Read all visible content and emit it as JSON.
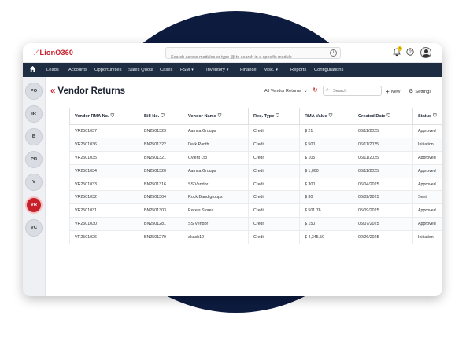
{
  "header": {
    "logo_mark": "⟋",
    "logo_text": "LionO",
    "logo_num": "360",
    "search_placeholder": "Search across modules or type @ to search in a specific module",
    "notif_count": "1",
    "icons": [
      "bell-icon",
      "help-icon",
      "user-avatar"
    ]
  },
  "nav": {
    "items": [
      {
        "label": "Leads",
        "dropdown": false
      },
      {
        "label": "Accounts",
        "dropdown": false
      },
      {
        "label": "Opportunities",
        "dropdown": false
      },
      {
        "label": "Sales Quota",
        "dropdown": false
      },
      {
        "label": "Cases",
        "dropdown": false
      },
      {
        "label": "FSM",
        "dropdown": true
      },
      {
        "label": "Inventory",
        "dropdown": true
      },
      {
        "label": "Finance",
        "dropdown": false
      },
      {
        "label": "Misc.",
        "dropdown": true
      },
      {
        "label": "Reports",
        "dropdown": false
      },
      {
        "label": "Configurations",
        "dropdown": false
      }
    ]
  },
  "sidebar": {
    "items": [
      {
        "label": "PO",
        "active": false
      },
      {
        "label": "IR",
        "active": false
      },
      {
        "label": "B",
        "active": false
      },
      {
        "label": "PR",
        "active": false
      },
      {
        "label": "V",
        "active": false
      },
      {
        "label": "VR",
        "active": true
      },
      {
        "label": "VC",
        "active": false
      }
    ]
  },
  "page": {
    "back_glyph": "«",
    "title": "Vendor Returns",
    "view_selector": "All Vendor Returns",
    "search_placeholder": "Search",
    "new_label": "New",
    "settings_label": "Settings"
  },
  "table": {
    "columns": [
      "Vendor RMA No.",
      "Bill No.",
      "Vendor Name",
      "Req. Type",
      "RMA Value",
      "Created Date",
      "Status"
    ],
    "rows": [
      [
        "VR2501037",
        "BN2501323",
        "Aamca Groups",
        "Credit",
        "$ 21",
        "06/11/2025",
        "Approved"
      ],
      [
        "VR2501036",
        "BN2501322",
        "Dark Panth",
        "Credit",
        "$ 500",
        "06/11/2025",
        "Initiation"
      ],
      [
        "VR2501035",
        "BN2501321",
        "Cylent Ltd",
        "Credit",
        "$ 105",
        "06/11/2025",
        "Approved"
      ],
      [
        "VR2501034",
        "BN2501320",
        "Aamca Groups",
        "Credit",
        "$ 1,000",
        "06/11/2025",
        "Approved"
      ],
      [
        "VR2501033",
        "BN2501316",
        "SS Vendor",
        "Credit",
        "$ 300",
        "06/04/2025",
        "Approved"
      ],
      [
        "VR2501032",
        "BN2501304",
        "Rock Band groups",
        "Credit",
        "$ 30",
        "06/02/2025",
        "Sent"
      ],
      [
        "VR2501031",
        "BN2501303",
        "Excels Stores",
        "Credit",
        "$ 501.76",
        "05/09/2025",
        "Approved"
      ],
      [
        "VR2501030",
        "BN2501281",
        "SS Vendor",
        "Credit",
        "$ 150",
        "05/07/2025",
        "Approved"
      ],
      [
        "VR2501026",
        "BN2501279",
        "akash12",
        "Credit",
        "$ 4,345.50",
        "02/26/2025",
        "Initiation"
      ]
    ]
  },
  "colors": {
    "accent": "#c7202a",
    "navbar": "#1e2d42",
    "background_circle": "#0d1b3f"
  }
}
